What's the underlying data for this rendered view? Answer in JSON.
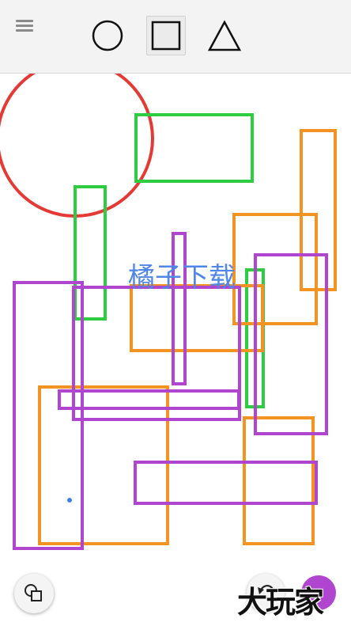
{
  "toolbar": {
    "tools": [
      {
        "name": "circle-tool",
        "icon": "circle-icon",
        "selected": false
      },
      {
        "name": "rectangle-tool",
        "icon": "square-icon",
        "selected": true
      },
      {
        "name": "triangle-tool",
        "icon": "triangle-icon",
        "selected": false
      }
    ]
  },
  "canvas": {
    "watermark_text": "橘子下载",
    "shape_colors": {
      "red": "#e53935",
      "green": "#2ecc40",
      "orange": "#f39322",
      "purple": "#b045cf",
      "dot": "#3d7fe8"
    }
  },
  "bottom": {
    "layers_icon": "layers-icon",
    "undo_icon": "undo-icon",
    "color_swatch": "#b045cf",
    "logo_text": "大玩家"
  }
}
